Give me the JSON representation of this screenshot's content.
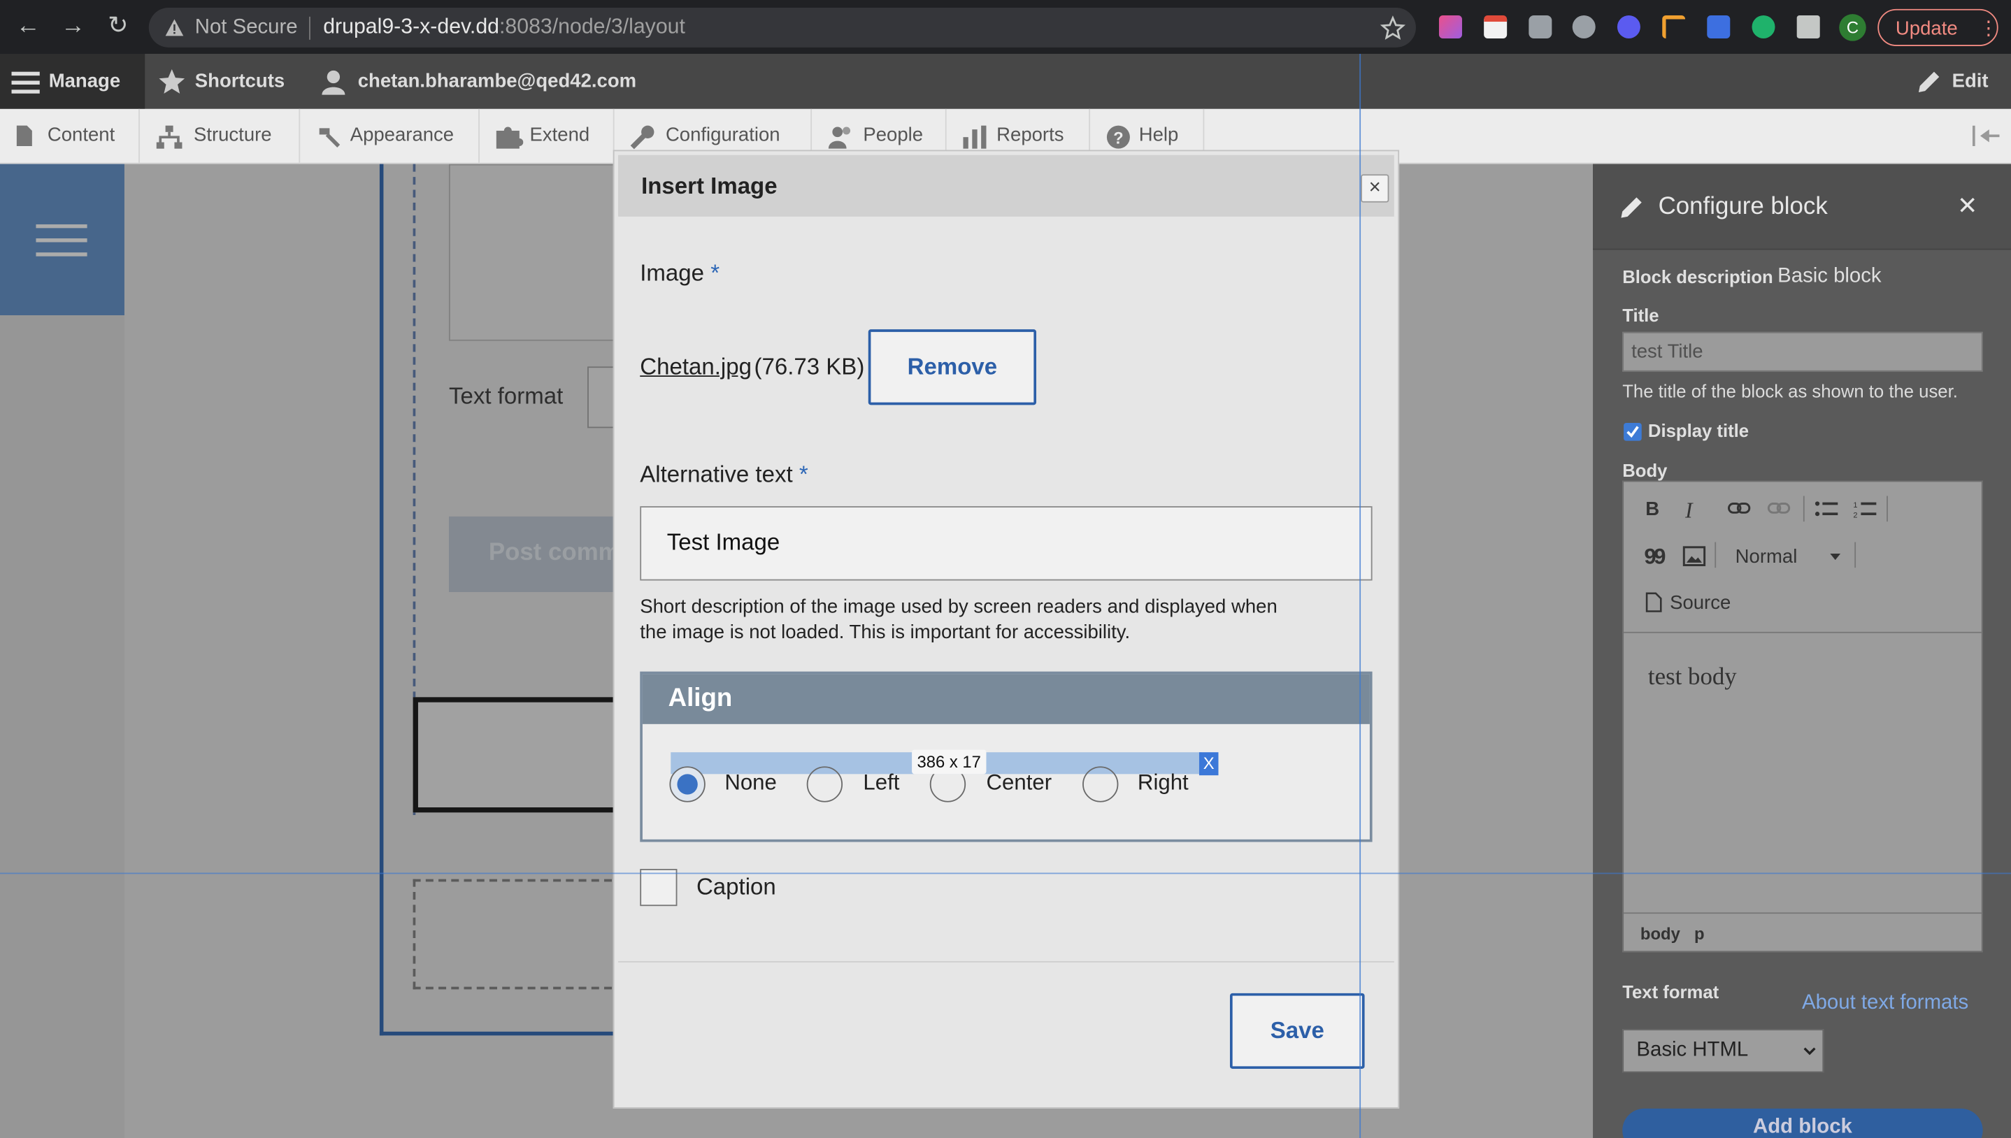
{
  "browser": {
    "back": "←",
    "forward": "→",
    "reload": "↻",
    "security": "Not Secure",
    "url_host": "drupal9-3-x-dev.dd",
    "url_path": ":8083/node/3/layout",
    "update_label": "Update",
    "profile_initial": "C"
  },
  "toolbar": {
    "manage": "Manage",
    "shortcuts": "Shortcuts",
    "user": "chetan.bharambe@qed42.com",
    "edit": "Edit",
    "tray": [
      "Content",
      "Structure",
      "Appearance",
      "Extend",
      "Configuration",
      "People",
      "Reports",
      "Help"
    ]
  },
  "background_page": {
    "text_format_label": "Text format",
    "post_button": "Post comment"
  },
  "dialog": {
    "title": "Insert Image",
    "close": "×",
    "image_label": "Image",
    "required_marker": "*",
    "file_name": "Chetan.jpg",
    "file_size": "(76.73 KB)",
    "remove_button": "Remove",
    "alt_label": "Alternative text",
    "alt_value": "Test Image",
    "alt_help": "Short description of the image used by screen readers and displayed when the image is not loaded. This is important for accessibility.",
    "align_title": "Align",
    "align_options": [
      "None",
      "Left",
      "Center",
      "Right"
    ],
    "align_selected": "None",
    "measure_tip": "386 x 17",
    "measure_close": "X",
    "caption_label": "Caption",
    "save_button": "Save"
  },
  "sidebar": {
    "title": "Configure block",
    "close": "✕",
    "block_desc_label": "Block description",
    "block_desc_value": "Basic block",
    "title_label": "Title",
    "title_value": "test Title",
    "title_help": "The title of the block as shown to the user.",
    "display_title_label": "Display title",
    "body_label": "Body",
    "editor": {
      "bold": "B",
      "italic": "I",
      "quote": "99",
      "format_select": "Normal",
      "source": "Source",
      "content": "test body",
      "path": [
        "body",
        "p"
      ]
    },
    "text_format_label": "Text format",
    "about_formats": "About text formats",
    "text_format_value": "Basic HTML",
    "add_block": "Add block"
  },
  "colors": {
    "accent": "#2c5fa8",
    "align_header": "#798a9a",
    "guide": "#3b78d2",
    "update": "#f28b82"
  }
}
